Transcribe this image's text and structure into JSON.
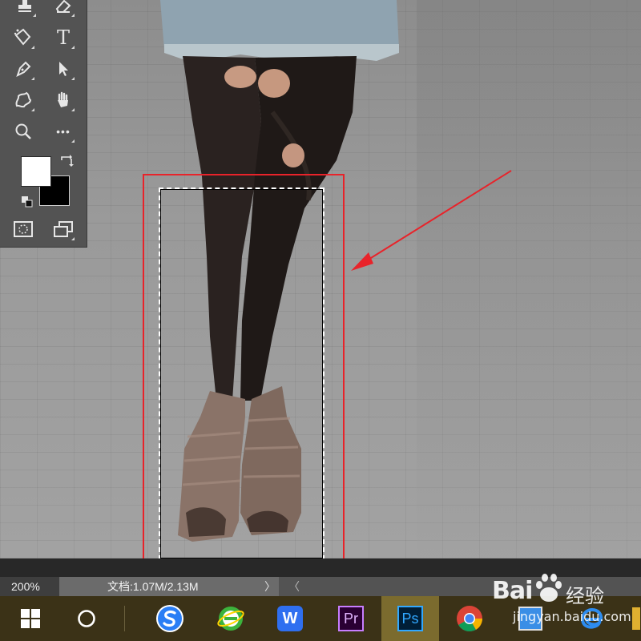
{
  "statusbar": {
    "zoom": "200%",
    "doc_info": "文档:1.07M/2.13M",
    "arrow": "〉",
    "scroll_left": "〈"
  },
  "tools": {
    "type_label": "T",
    "more_label": "•••"
  },
  "colors": {
    "foreground": "#ffffff",
    "background": "#000000",
    "highlight": "#e8232a"
  },
  "taskbar": {
    "word_label": "W",
    "premiere_label": "Pr",
    "photoshop_label": "Ps"
  },
  "watermark": {
    "brand": "Bai",
    "brand_cn": "经验",
    "url": "jingyan.baidu.com"
  }
}
